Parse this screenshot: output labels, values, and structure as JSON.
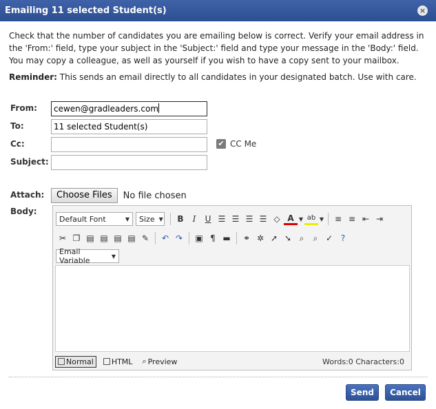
{
  "window": {
    "title": "Emailing 11 selected Student(s)",
    "close_glyph": "×"
  },
  "intro_text": "Check that the number of candidates you are emailing below is correct.  Verify your email address in the 'From:' field, type your subject in the 'Subject:' field and type your message in the 'Body:' field.  You may copy a colleague, as well as yourself if you wish to have a copy sent to your mailbox.",
  "reminder": {
    "label": "Reminder:",
    "text": " This sends an email directly to all candidates in your designated batch.  Use with care."
  },
  "form": {
    "from_label": "From:",
    "from_value": "cewen@gradleaders.com",
    "to_label": "To:",
    "to_value": "11 selected Student(s)",
    "cc_label": "Cc:",
    "cc_value": "",
    "cc_me_label": "CC Me",
    "cc_me_checked": true,
    "subject_label": "Subject:",
    "subject_value": "",
    "attach_label": "Attach:",
    "choose_files_label": "Choose Files",
    "no_file_text": "No file chosen",
    "body_label": "Body:"
  },
  "editor": {
    "font_select": "Default Font",
    "size_select": "Size",
    "email_variable_select": "Email Variable",
    "modes": {
      "normal": "Normal",
      "html": "HTML",
      "preview": "Preview"
    },
    "word_count": "Words:0 Characters:0",
    "body_value": ""
  },
  "buttons": {
    "send": "Send",
    "cancel": "Cancel"
  },
  "colors": {
    "titlebar": "#3f62a8",
    "button": "#3b63ad"
  }
}
